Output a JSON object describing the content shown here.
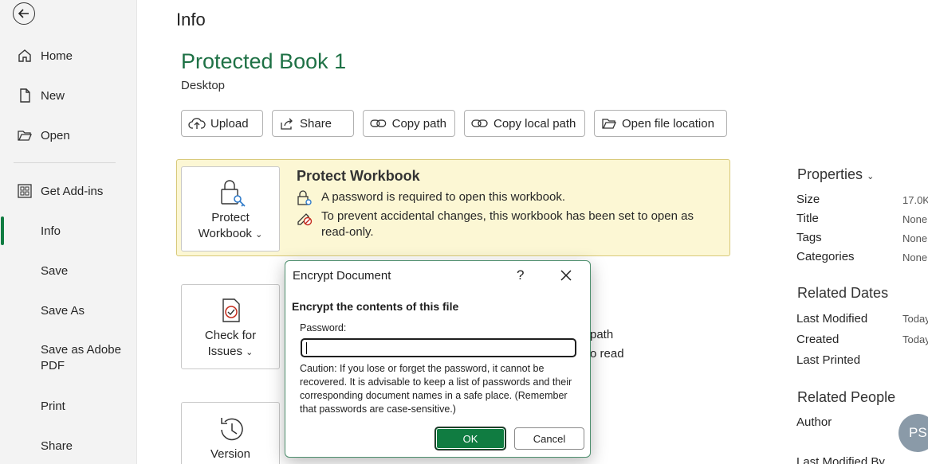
{
  "sidebar": {
    "items": [
      {
        "label": "Home",
        "icon": "home-icon"
      },
      {
        "label": "New",
        "icon": "new-document-icon"
      },
      {
        "label": "Open",
        "icon": "folder-open-icon"
      },
      {
        "label": "Get Add-ins",
        "icon": "add-ins-grid-icon"
      },
      {
        "label": "Info",
        "selected": true
      },
      {
        "label": "Save"
      },
      {
        "label": "Save As"
      },
      {
        "label": "Save as Adobe PDF"
      },
      {
        "label": "Print"
      },
      {
        "label": "Share"
      }
    ]
  },
  "main": {
    "page_title": "Info",
    "doc_title": "Protected Book 1",
    "doc_location": "Desktop",
    "actions": [
      "Upload",
      "Share",
      "Copy path",
      "Copy local path",
      "Open file location"
    ],
    "protect": {
      "tile_label_line1": "Protect",
      "tile_label_line2": "Workbook",
      "heading": "Protect Workbook",
      "line1": "A password is required to open this workbook.",
      "line2": "To prevent accidental changes, this workbook has been set to open as read-only."
    },
    "inspect": {
      "tile_label_line1": "Check for",
      "tile_label_line2": "Issues",
      "behind_text1": "path",
      "behind_text2": "o read"
    },
    "version": {
      "tile_label": "Version"
    }
  },
  "properties": {
    "heading": "Properties",
    "rows": [
      {
        "key": "Size",
        "value": "17.0K"
      },
      {
        "key": "Title",
        "value": "None"
      },
      {
        "key": "Tags",
        "value": "None"
      },
      {
        "key": "Categories",
        "value": "None"
      }
    ],
    "related_dates_heading": "Related Dates",
    "dates": [
      {
        "key": "Last Modified",
        "value": "Today"
      },
      {
        "key": "Created",
        "value": "Today"
      },
      {
        "key": "Last Printed",
        "value": ""
      }
    ],
    "related_people_heading": "Related People",
    "author_label": "Author",
    "author_initials": "PS",
    "last_modified_by": "Last Modified By"
  },
  "dialog": {
    "title": "Encrypt Document",
    "help": "?",
    "subtitle": "Encrypt the contents of this file",
    "password_label": "Password:",
    "password_value": "",
    "caution": "Caution: If you lose or forget the password, it cannot be recovered. It is advisable to keep a list of passwords and their corresponding document names in a safe place. (Remember that passwords are case-sensitive.)",
    "ok_label": "OK",
    "cancel_label": "Cancel"
  },
  "colors": {
    "accent": "#107c41",
    "title_green": "#1e7145",
    "protect_bg": "#fcf7d4"
  }
}
